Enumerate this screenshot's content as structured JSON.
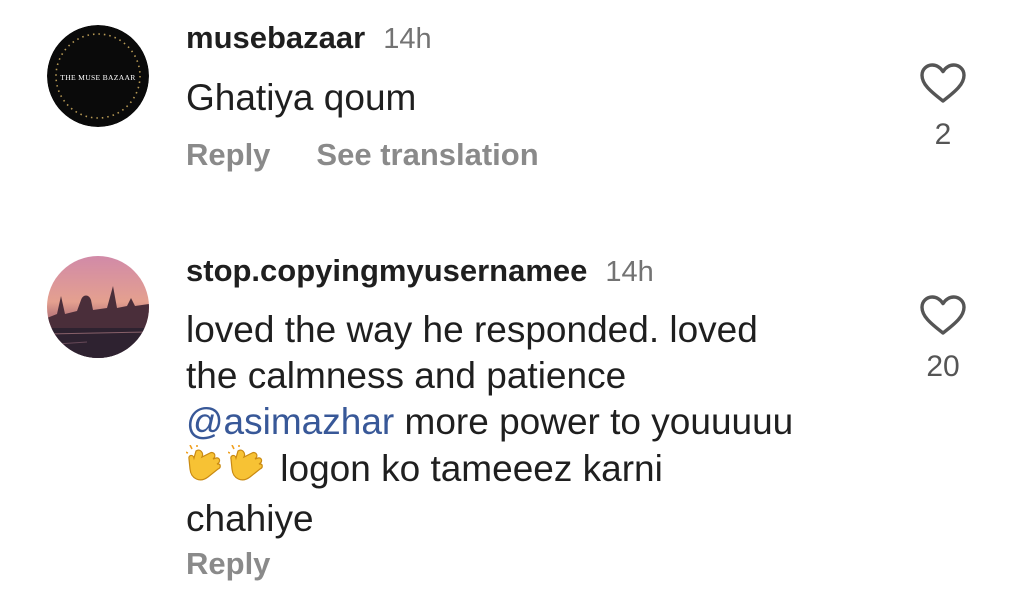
{
  "comments": [
    {
      "username": "musebazaar",
      "timestamp": "14h",
      "avatar_text": "THE MUSE BAZAAR",
      "text": "Ghatiya qoum",
      "like_count": "2",
      "actions": {
        "reply": "Reply",
        "translate": "See translation"
      }
    },
    {
      "username": "stop.copyingmyusernamee",
      "timestamp": "14h",
      "text_line1": "loved the way he responded. loved",
      "text_line2": "the calmness and patience",
      "mention": "@asimazhar",
      "text_line3_rest": " more power to youuuuu",
      "text_line4_rest": " logon ko tameeez karni",
      "text_line5": "chahiye",
      "emoji_name": "clapping-hands-icon",
      "like_count": "20",
      "actions": {
        "reply": "Reply"
      }
    }
  ],
  "colors": {
    "text": "#1f1f1f",
    "muted": "#737373",
    "action": "#8a8a8a",
    "mention": "#385898"
  }
}
